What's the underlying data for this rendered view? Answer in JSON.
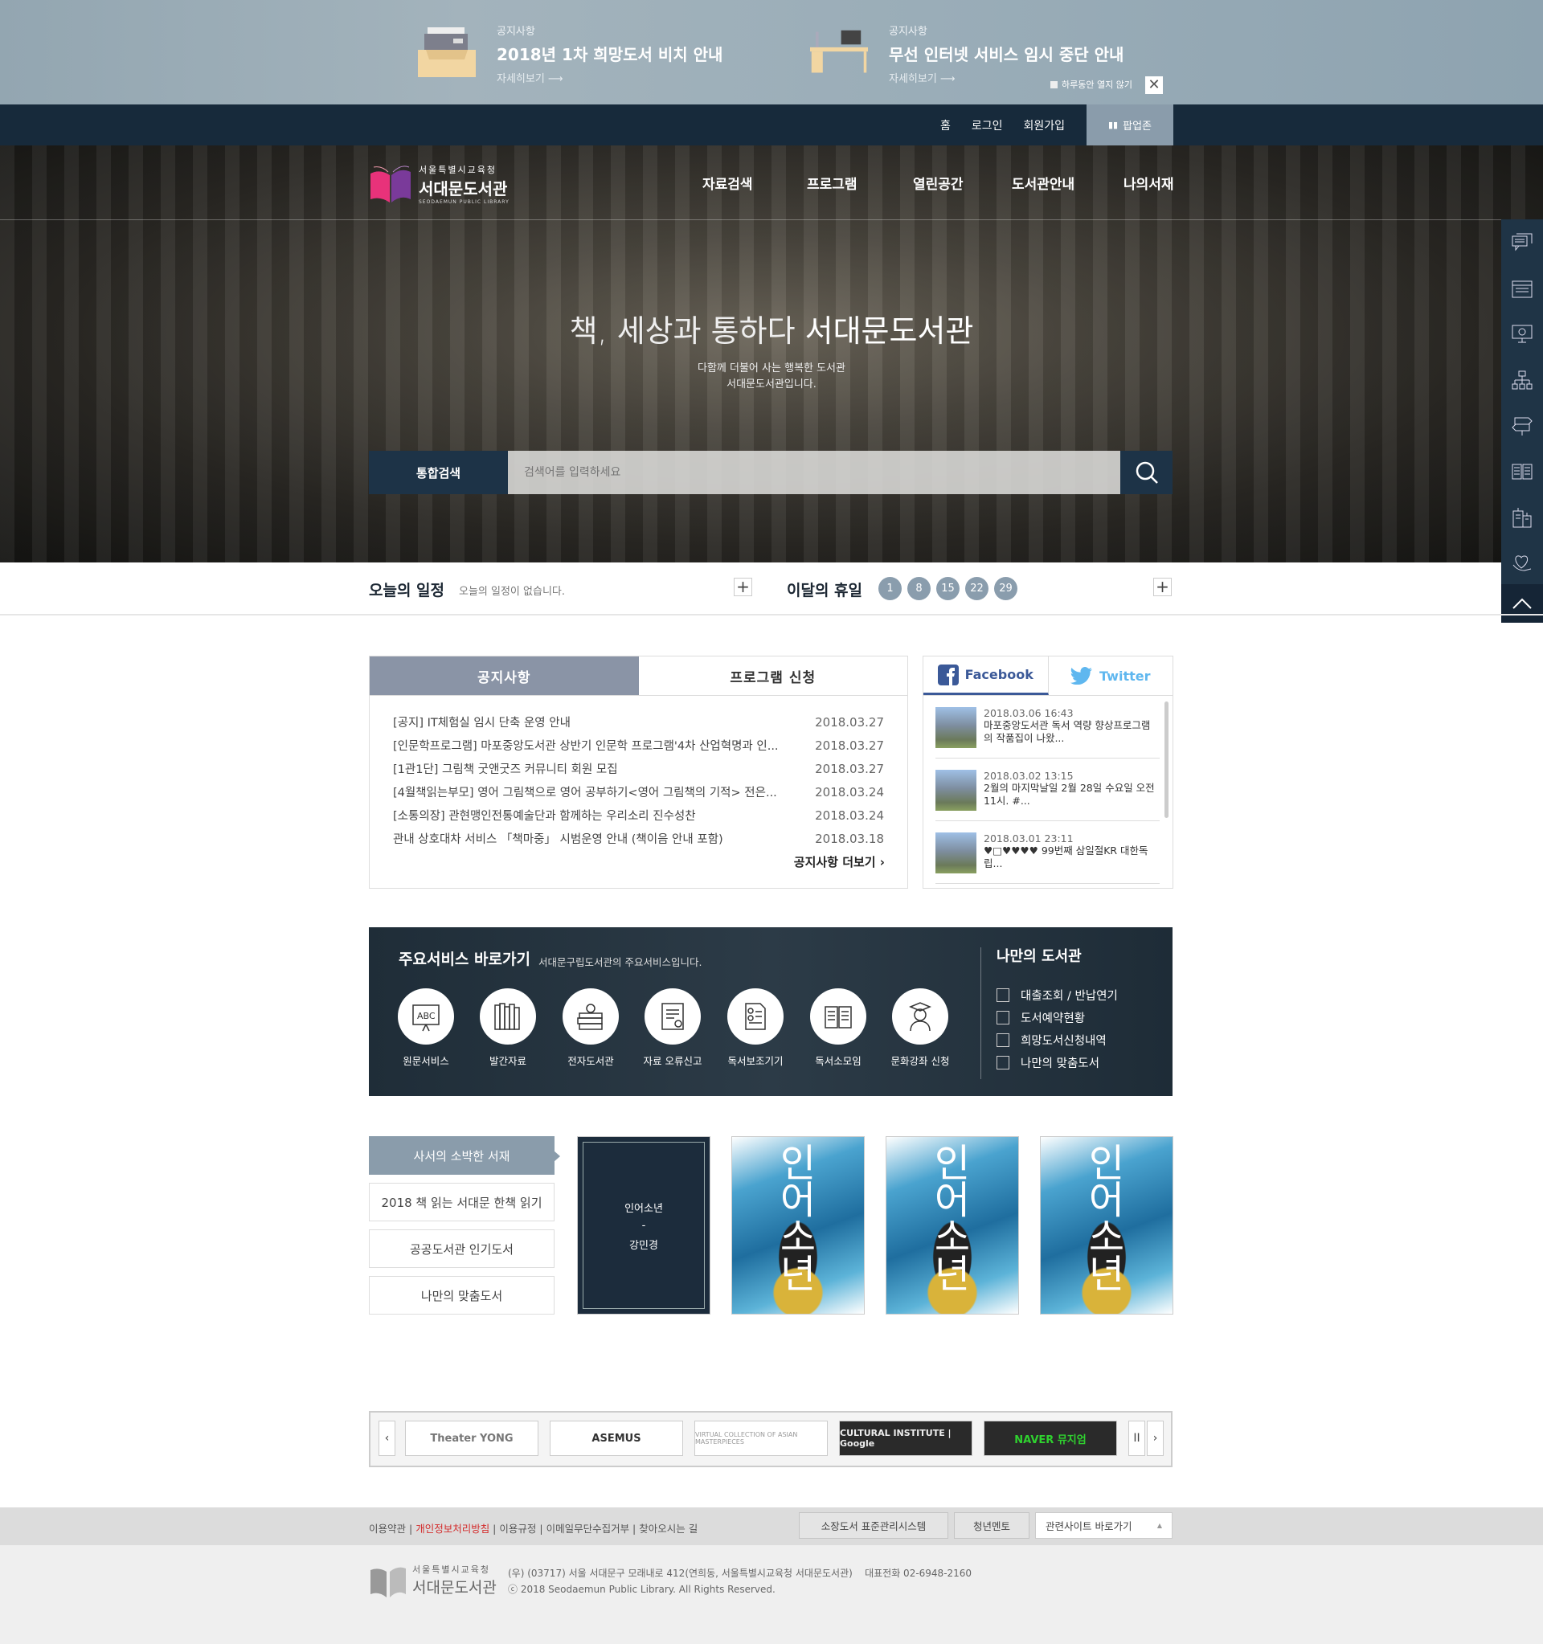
{
  "popups": [
    {
      "category": "공지사항",
      "title": "2018년 1차 희망도서 비치 안내",
      "more": "자세히보기 ⟶"
    },
    {
      "category": "공지사항",
      "title": "무선 인터넷 서비스 임시 중단 안내",
      "more": "자세히보기 ⟶"
    }
  ],
  "popup_close": {
    "no_show_today": "하루동안 열지 않기",
    "close": "✕"
  },
  "util": {
    "home": "홈",
    "login": "로그인",
    "join": "회원가입",
    "popup_zone": "팝업존"
  },
  "logo": {
    "org": "서울특별시교육청",
    "name": "서대문도서관",
    "eng": "SEODAEMUN PUBLIC LIBRARY"
  },
  "nav": [
    "자료검색",
    "프로그램",
    "열린공간",
    "도서관안내",
    "나의서재"
  ],
  "hero": {
    "title_light": "책, 세상과 통하다 ",
    "title_bold": "서대문도서관",
    "sub1": "다함께 더불어 사는 행복한 도서관",
    "sub2": "서대문도서관입니다."
  },
  "search": {
    "label": "통합검색",
    "placeholder": "검색어를 입력하세요"
  },
  "quick_icons": [
    "chat-icon",
    "calendar-icon",
    "monitor-globe-icon",
    "sitemap-icon",
    "signpost-icon",
    "open-book-icon",
    "building-icon",
    "heart-hand-icon"
  ],
  "today": {
    "title": "오늘의 일정",
    "message": "오늘의 일정이 없습니다.",
    "plus": "+"
  },
  "holiday": {
    "title": "이달의 휴일",
    "days": [
      "1",
      "8",
      "15",
      "22",
      "29"
    ],
    "plus": "+"
  },
  "notice": {
    "tabs": [
      "공지사항",
      "프로그램 신청"
    ],
    "items": [
      {
        "title": "[공지] IT체험실 임시 단축 운영 안내",
        "date": "2018.03.27"
      },
      {
        "title": "[인문학프로그램] 마포중앙도서관 상반기 인문학 프로그램'4차 산업혁명과 인...",
        "date": "2018.03.27"
      },
      {
        "title": "[1관1단] 그림책 굿앤굿즈 커뮤니티 회원 모집",
        "date": "2018.03.27"
      },
      {
        "title": "[4월책읽는부모] 영어 그림책으로 영어 공부하기<영어 그림책의 기적> 전은...",
        "date": "2018.03.24"
      },
      {
        "title": "[소통의장] 관현맹인전통예술단과 함께하는 우리소리 진수성찬",
        "date": "2018.03.24"
      },
      {
        "title": "관내 상호대차 서비스 「책마중」 시범운영 안내 (책이음 안내 포함)",
        "date": "2018.03.18"
      }
    ],
    "more": "공지사항 더보기 ›"
  },
  "social": {
    "tabs": [
      "Facebook",
      "Twitter"
    ],
    "posts": [
      {
        "date": "2018.03.06 16:43",
        "text": "마포중앙도서관 독서 역량 향상프로그램 의 작품집이 나왔..."
      },
      {
        "date": "2018.03.02 13:15",
        "text": "2월의 마지막날일 2월 28일 수요일 오전 11시. #..."
      },
      {
        "date": "2018.03.01 23:11",
        "text": "♥□♥♥♥♥ 99번째 삼일절KR 대한독립..."
      }
    ]
  },
  "services": {
    "title": "주요서비스 바로가기",
    "desc": "서대문구립도서관의 주요서비스입니다.",
    "items": [
      "원문서비스",
      "발간자료",
      "전자도서관",
      "자료 오류신고",
      "독서보조기기",
      "독서소모임",
      "문화강좌 신청"
    ],
    "my_title": "나만의 도서관",
    "my_items": [
      "대출조회 / 반납연기",
      "도서예약현황",
      "희망도서신청내역",
      "나만의 맞춤도서"
    ]
  },
  "books": {
    "menu": [
      "사서의 소박한 서재",
      "2018 책 읽는 서대문 한책 읽기",
      "공공도서관 인기도서",
      "나만의 맞춤도서"
    ],
    "hover": {
      "title": "인어소년",
      "sep": "-",
      "author": "강민경"
    },
    "cover_title": "인어소년"
  },
  "partners": {
    "prev": "‹",
    "next": "›",
    "pause": "II",
    "items": [
      "Theater YONG",
      "ASEMUS",
      "VIRTUAL COLLECTION OF ASIAN MASTERPIECES",
      "CULTURAL INSTITUTE | Google",
      "NAVER 뮤지엄"
    ]
  },
  "footer": {
    "links": [
      "이용약관",
      "개인정보처리방침",
      "이용규정",
      "이메일무단수집거부",
      "찾아오시는 길"
    ],
    "btn1": "소장도서 표준관리시스템",
    "btn2": "청년멘토",
    "related": "관련사이트 바로가기",
    "related_arrow": "▲",
    "address": "(우) (03717) 서울 서대문구 모래내로 412(연희동, 서울특별시교육청 서대문도서관)",
    "phone": "대표전화  02-6948-2160",
    "copyright": "ⓒ 2018 Seodaemun Public Library. All Rights Reserved.",
    "logo_org": "서울특별시교육청",
    "logo_name": "서대문도서관"
  },
  "colors": {
    "navy": "#172a3b",
    "accent_gray": "#8a9cab",
    "facebook": "#3b5998",
    "twitter": "#5fb7ef",
    "red_link": "#d32b2b"
  }
}
